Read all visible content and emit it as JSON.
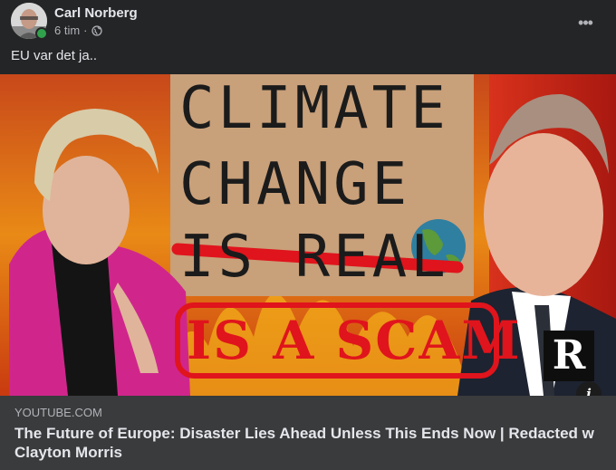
{
  "post": {
    "author": "Carl Norberg",
    "time": "6 tim",
    "separator": "·",
    "privacy_icon": "globe-icon",
    "more_icon": "more-options-icon",
    "text": "EU var det ja.."
  },
  "thumbnail": {
    "sign_lines": [
      "CLIMATE",
      "CHANGE",
      "IS REAL"
    ],
    "stamp_text": "IS A SCAM",
    "channel_logo": "R"
  },
  "link": {
    "domain": "YOUTUBE.COM",
    "title": "The Future of Europe: Disaster Lies Ahead Unless This Ends Now | Redacted w Clayton Morris",
    "info_icon": "i"
  },
  "colors": {
    "background": "#242526",
    "footer": "#3a3b3c",
    "online": "#31a24c",
    "stamp_red": "#e0141c"
  }
}
